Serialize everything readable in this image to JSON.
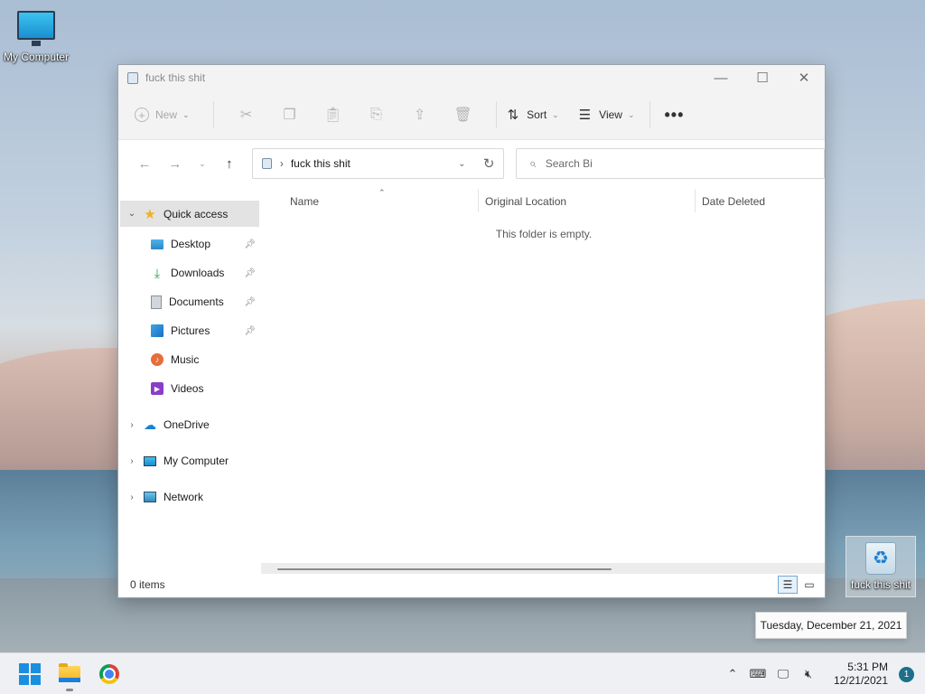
{
  "desktop": {
    "my_computer_label": "My Computer",
    "recycle_bin_label": "fuck this shit"
  },
  "window": {
    "title": "fuck this shit",
    "controls": {
      "minimize": "—",
      "maximize": "☐",
      "close": "✕"
    }
  },
  "toolbar": {
    "new_label": "New",
    "sort_label": "Sort",
    "view_label": "View",
    "more_label": "•••",
    "icons": [
      "cut-icon",
      "copy-icon",
      "paste-icon",
      "rename-icon",
      "share-icon",
      "delete-icon"
    ]
  },
  "navbar": {
    "address_path": "fuck this shit",
    "search_placeholder": "Search Bi"
  },
  "sidebar": {
    "quick_access": "Quick access",
    "items": [
      {
        "label": "Desktop",
        "pinned": true,
        "icon": "desktop-icon"
      },
      {
        "label": "Downloads",
        "pinned": true,
        "icon": "download-icon"
      },
      {
        "label": "Documents",
        "pinned": true,
        "icon": "documents-icon"
      },
      {
        "label": "Pictures",
        "pinned": true,
        "icon": "pictures-icon"
      },
      {
        "label": "Music",
        "pinned": false,
        "icon": "music-icon"
      },
      {
        "label": "Videos",
        "pinned": false,
        "icon": "videos-icon"
      }
    ],
    "onedrive": "OneDrive",
    "my_computer": "My Computer",
    "network": "Network"
  },
  "filepane": {
    "columns": [
      "Name",
      "Original Location",
      "Date Deleted"
    ],
    "empty_message": "This folder is empty."
  },
  "status": {
    "item_count": "0 items"
  },
  "tooltip": {
    "date_long": "Tuesday, December 21, 2021"
  },
  "taskbar": {
    "apps": [
      "start-icon",
      "file-explorer-icon",
      "chrome-icon"
    ],
    "time": "5:31 PM",
    "date": "12/21/2021",
    "notification_count": "1"
  },
  "colors": {
    "accent": "#1a8fe0",
    "window_bg": "#ffffff",
    "toolbar_bg": "#f3f3f3",
    "selected_bg": "#e3e3e3"
  }
}
